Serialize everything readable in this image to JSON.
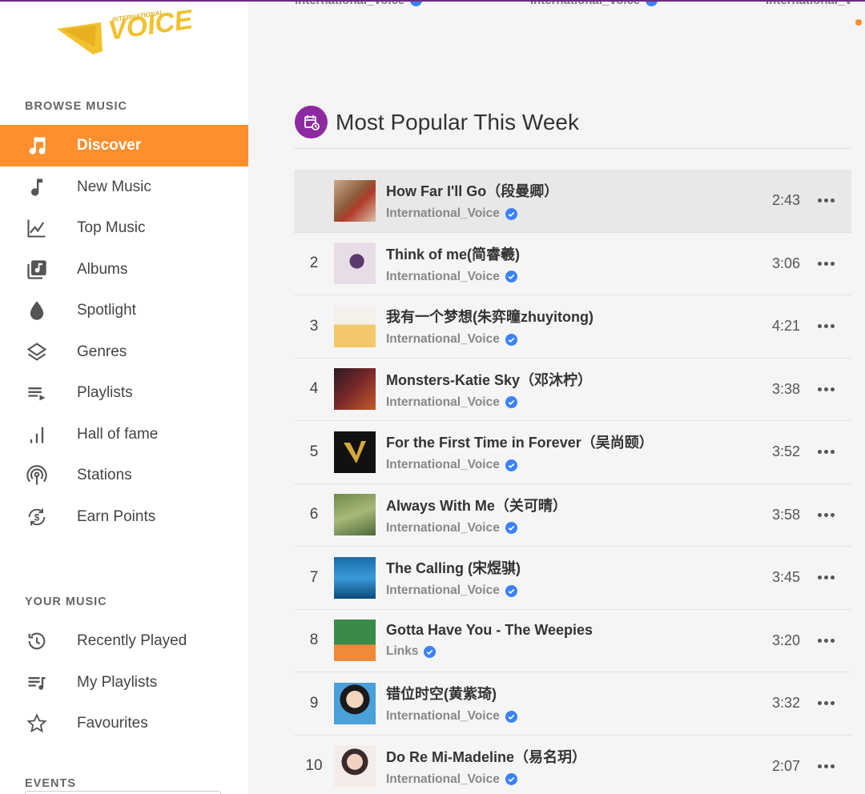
{
  "logo": {
    "text": "VOICE",
    "subtext": "INTERNATIONAL"
  },
  "sidebar": {
    "browse_title": "BROWSE MUSIC",
    "browse": [
      {
        "label": "Discover",
        "icon": "music-notes-icon",
        "active": true
      },
      {
        "label": "New Music",
        "icon": "music-note-icon"
      },
      {
        "label": "Top Music",
        "icon": "trending-chart-icon"
      },
      {
        "label": "Albums",
        "icon": "album-library-icon"
      },
      {
        "label": "Spotlight",
        "icon": "drop-icon"
      },
      {
        "label": "Genres",
        "icon": "layers-icon"
      },
      {
        "label": "Playlists",
        "icon": "playlist-icon"
      },
      {
        "label": "Hall of fame",
        "icon": "bar-chart-icon"
      },
      {
        "label": "Stations",
        "icon": "radio-tower-icon"
      },
      {
        "label": "Earn Points",
        "icon": "coin-cycle-icon"
      }
    ],
    "your_title": "YOUR MUSIC",
    "your": [
      {
        "label": "Recently Played",
        "icon": "history-icon"
      },
      {
        "label": "My Playlists",
        "icon": "my-playlist-icon"
      },
      {
        "label": "Favourites",
        "icon": "star-icon"
      }
    ],
    "events_title": "EVENTS"
  },
  "artist_strip": [
    "International_Voice",
    "International_Voice",
    "International_V"
  ],
  "section": {
    "title": "Most Popular This Week"
  },
  "tracks": [
    {
      "num": "",
      "title": "How Far I'll Go（段曼卿）",
      "artist": "International_Voice",
      "duration": "2:43"
    },
    {
      "num": "2",
      "title": "Think of me(简睿羲)",
      "artist": "International_Voice",
      "duration": "3:06"
    },
    {
      "num": "3",
      "title": "我有一个梦想(朱弈曈zhuyitong)",
      "artist": "International_Voice",
      "duration": "4:21"
    },
    {
      "num": "4",
      "title": "Monsters-Katie Sky（邓沐柠）",
      "artist": "International_Voice",
      "duration": "3:38"
    },
    {
      "num": "5",
      "title": "For the First Time in Forever（吴尚颐）",
      "artist": "International_Voice",
      "duration": "3:52"
    },
    {
      "num": "6",
      "title": "Always With Me（关可晴）",
      "artist": "International_Voice",
      "duration": "3:58"
    },
    {
      "num": "7",
      "title": "The Calling (宋煜骐)",
      "artist": "International_Voice",
      "duration": "3:45"
    },
    {
      "num": "8",
      "title": "Gotta Have You - The Weepies",
      "artist": "Links",
      "duration": "3:20"
    },
    {
      "num": "9",
      "title": "错位时空(黄紫琦)",
      "artist": "International_Voice",
      "duration": "3:32"
    },
    {
      "num": "10",
      "title": "Do Re Mi-Madeline（易名玥）",
      "artist": "International_Voice",
      "duration": "2:07"
    }
  ],
  "colors": {
    "accent": "#fd8f2e",
    "heading_icon": "#8e2aa0",
    "verified": "#3b82f6"
  }
}
